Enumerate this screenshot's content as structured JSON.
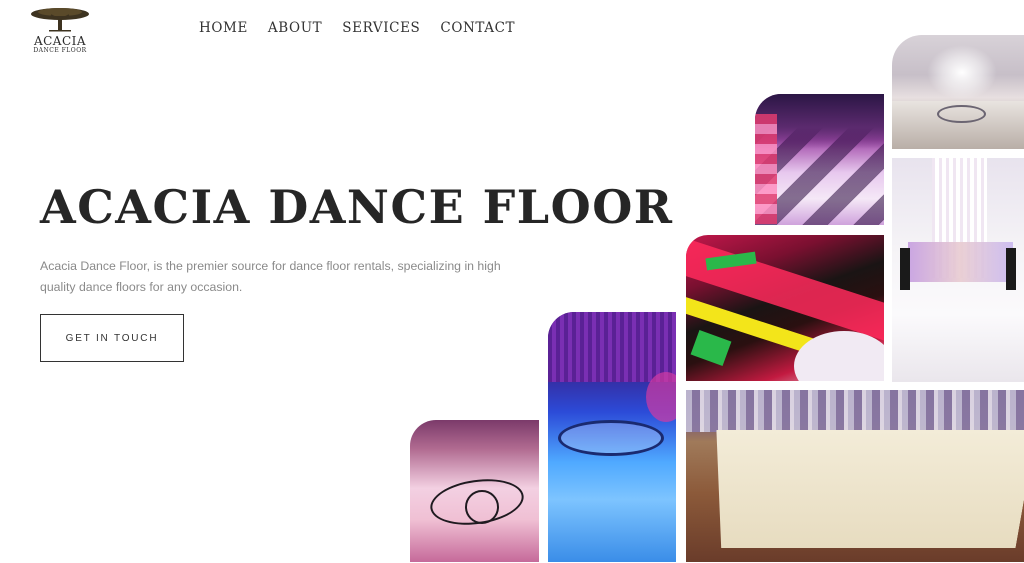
{
  "logo": {
    "brand": "ACACIA",
    "tagline": "DANCE FLOOR",
    "icon": "acacia-tree-icon"
  },
  "nav": {
    "items": [
      {
        "label": "HOME"
      },
      {
        "label": "ABOUT"
      },
      {
        "label": "SERVICES"
      },
      {
        "label": "CONTACT"
      }
    ]
  },
  "hero": {
    "title": "ACACIA DANCE FLOOR",
    "description": "Acacia Dance Floor, is the premier source for dance floor rentals, specializing in high quality dance floors for any occasion.",
    "cta_label": "GET IN TOUCH"
  },
  "colors": {
    "background": "#ffffff",
    "text": "#262626",
    "muted_text": "#8a8a8a"
  }
}
